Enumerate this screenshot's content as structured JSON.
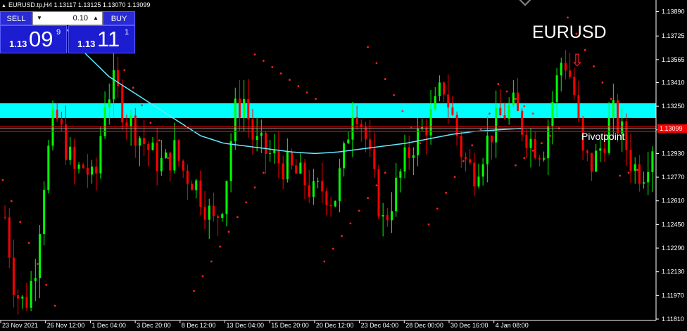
{
  "header": {
    "symbol_line": "EURUSD.tp,H4  1.13117 1.13125 1.13070 1.13099"
  },
  "trade_panel": {
    "sell_label": "SELL",
    "buy_label": "BUY",
    "lot_value": "0.10",
    "sell_price": {
      "prefix": "1.13",
      "big": "09",
      "sup": "9"
    },
    "buy_price": {
      "prefix": "1.13",
      "big": "11",
      "sup": "1"
    }
  },
  "annotations": {
    "symbol": "EURUSD",
    "arrow": "⇩",
    "pivot_label": "Pivotpoint"
  },
  "colors": {
    "bull": "#00ff00",
    "bear": "#ff0000",
    "ma": "#66e8ff",
    "zone": "#00ffff",
    "sar": "#ff2020",
    "pivot": "#ff0000",
    "price_tag_bg": "#ff0000"
  },
  "chart_data": {
    "type": "candlestick",
    "symbol": "EURUSD",
    "timeframe": "H4",
    "y_axis": {
      "min": 1.1181,
      "max": 1.1394,
      "ticks": [
        "1.13890",
        "1.13725",
        "1.13565",
        "1.13410",
        "1.13250",
        "1.13090",
        "1.12930",
        "1.12770",
        "1.12610",
        "1.12450",
        "1.12290",
        "1.12130",
        "1.11970",
        "1.11810"
      ]
    },
    "x_axis": {
      "ticks": [
        "23 Nov 2021",
        "26 Nov 12:00",
        "1 Dec 04:00",
        "3 Dec 20:00",
        "8 Dec 12:00",
        "13 Dec 04:00",
        "15 Dec 20:00",
        "20 Dec 12:00",
        "23 Dec 04:00",
        "28 Dec 00:00",
        "30 Dec 16:00",
        "4 Jan 08:00"
      ]
    },
    "current_price": "1.13099",
    "current_price_tag": "1.13099",
    "resistance_zone": {
      "from": 1.1317,
      "to": 1.1327
    },
    "pivot_lines": [
      1.1311,
      1.1308
    ],
    "close_path": [
      1.125,
      1.12,
      1.119,
      1.1215,
      1.128,
      1.132,
      1.13,
      1.128,
      1.1285,
      1.127,
      1.133,
      1.134,
      1.132,
      1.131,
      1.13,
      1.129,
      1.1285,
      1.1295,
      1.128,
      1.1275,
      1.126,
      1.1245,
      1.1265,
      1.132,
      1.133,
      1.13,
      1.1295,
      1.129,
      1.1285,
      1.128,
      1.1275,
      1.1265,
      1.127,
      1.126,
      1.129,
      1.133,
      1.131,
      1.1275,
      1.1245,
      1.1265,
      1.1285,
      1.13,
      1.131,
      1.132,
      1.134,
      1.1315,
      1.129,
      1.128,
      1.1295,
      1.131,
      1.132,
      1.1325,
      1.131,
      1.13,
      1.1295,
      1.133,
      1.136,
      1.134,
      1.129,
      1.1285,
      1.13,
      1.132,
      1.1305,
      1.1285,
      1.128,
      1.13
    ],
    "ma_path": [
      1.138,
      1.136,
      1.1345,
      1.1335,
      1.1325,
      1.1315,
      1.1305,
      1.13,
      1.1298,
      1.1296,
      1.1294,
      1.1293,
      1.1294,
      1.1296,
      1.1298,
      1.13,
      1.1303,
      1.1306,
      1.1308,
      1.1309,
      1.131
    ],
    "sar_segments": [
      {
        "from": 1.1275,
        "to": 1.119,
        "steps": 7,
        "start": 0
      },
      {
        "from": 1.1385,
        "to": 1.129,
        "steps": 9,
        "start": 11
      },
      {
        "from": 1.12,
        "to": 1.128,
        "steps": 9,
        "start": 22
      },
      {
        "from": 1.136,
        "to": 1.133,
        "steps": 8,
        "start": 29
      },
      {
        "from": 1.122,
        "to": 1.128,
        "steps": 8,
        "start": 37
      },
      {
        "from": 1.1365,
        "to": 1.13,
        "steps": 7,
        "start": 42
      },
      {
        "from": 1.1245,
        "to": 1.132,
        "steps": 8,
        "start": 49
      },
      {
        "from": 1.134,
        "to": 1.132,
        "steps": 5,
        "start": 57
      },
      {
        "from": 1.1285,
        "to": 1.131,
        "steps": 6,
        "start": 59
      },
      {
        "from": 1.1385,
        "to": 1.133,
        "steps": 6,
        "start": 65
      },
      {
        "from": 1.1278,
        "to": 1.1282,
        "steps": 3,
        "start": 71
      }
    ]
  }
}
